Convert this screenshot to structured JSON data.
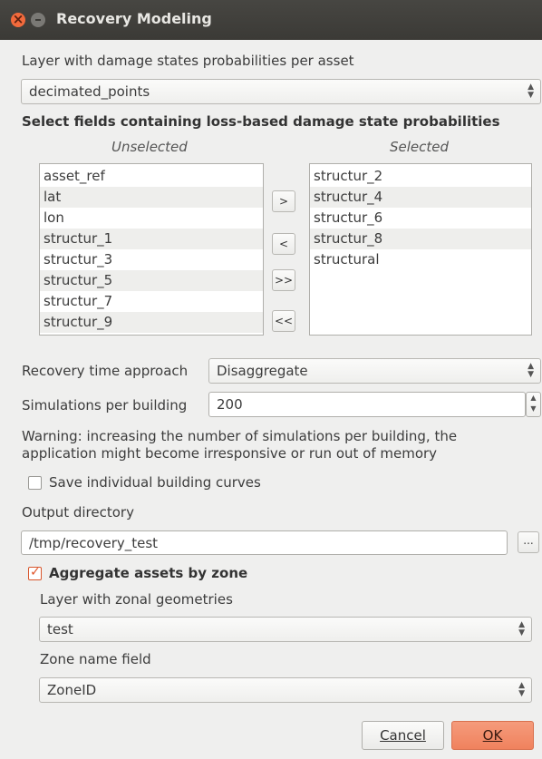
{
  "window": {
    "title": "Recovery Modeling"
  },
  "damage_layer": {
    "label": "Layer with damage states probabilities per asset",
    "value": "decimated_points"
  },
  "fields": {
    "heading": "Select fields containing loss-based damage state probabilities",
    "unselected_label": "Unselected",
    "selected_label": "Selected",
    "unselected": [
      "asset_ref",
      "lat",
      "lon",
      "structur_1",
      "structur_3",
      "structur_5",
      "structur_7",
      "structur_9"
    ],
    "selected": [
      "structur_2",
      "structur_4",
      "structur_6",
      "structur_8",
      "structural"
    ],
    "buttons": [
      ">",
      "<",
      ">>",
      "<<"
    ]
  },
  "recovery": {
    "label": "Recovery time approach",
    "value": "Disaggregate"
  },
  "simulations": {
    "label": "Simulations per building",
    "value": "200",
    "warning_line1": "Warning: increasing the number of simulations per building, the",
    "warning_line2": "application might become irresponsive or run out of memory"
  },
  "save_curves": {
    "label": "Save individual building curves",
    "checked": false
  },
  "output": {
    "label": "Output directory",
    "value": "/tmp/recovery_test",
    "browse": "..."
  },
  "aggregate": {
    "label": "Aggregate assets by zone",
    "checked": true,
    "zone_layer_label": "Layer with zonal geometries",
    "zone_layer_value": "test",
    "zone_field_label": "Zone name field",
    "zone_field_value": "ZoneID"
  },
  "buttons": {
    "cancel": "Cancel",
    "ok": "OK"
  }
}
